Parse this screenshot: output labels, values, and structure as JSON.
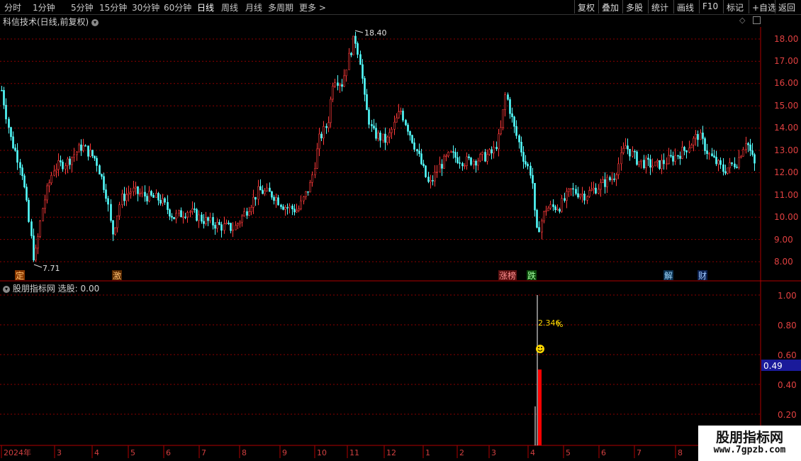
{
  "toolbar": {
    "tabs": [
      "分时",
      "1分钟",
      "5分钟",
      "15分钟",
      "30分钟",
      "60分钟",
      "日线",
      "周线",
      "月线",
      "多周期",
      "更多 >"
    ],
    "active_tab": "日线",
    "right_buttons": [
      "复权",
      "叠加",
      "多股",
      "统计",
      "画线",
      "F10",
      "标记",
      "+自选",
      "返回"
    ]
  },
  "main_chart": {
    "title": "科信技术(日线,前复权)",
    "price_labels": [
      "18.00",
      "17.00",
      "16.00",
      "15.00",
      "14.00",
      "13.00",
      "12.00",
      "11.00",
      "10.00",
      "9.00",
      "8.00"
    ],
    "high_marker": "18.40",
    "low_marker": "7.71",
    "event_tags": [
      {
        "text": "定",
        "color": "#ffb060",
        "bg": "#8a3a00"
      },
      {
        "text": "激",
        "color": "#ffb060",
        "bg": "#5a2a00"
      },
      {
        "text": "涨榜",
        "color": "#ff9090",
        "bg": "#5a1010"
      },
      {
        "text": "跌",
        "color": "#a0ffa0",
        "bg": "#0a4a0a"
      },
      {
        "text": "解",
        "color": "#9fd8ff",
        "bg": "#0a3050"
      },
      {
        "text": "财",
        "color": "#9fc8ff",
        "bg": "#0a2050"
      }
    ]
  },
  "indicator": {
    "title": "股朋指标网",
    "value_label": "选股:",
    "value": "0.00",
    "scale_labels": [
      "1.00",
      "0.80",
      "0.60",
      "0.40",
      "0.20"
    ],
    "current_value_box": "0.49",
    "annotation": "2.346",
    "percent_sign": "%",
    "smiley_icon": "smiley-face-icon"
  },
  "timeline": {
    "labels": [
      "2024年",
      "3",
      "4",
      "5",
      "6",
      "7",
      "8",
      "9",
      "10",
      "11",
      "12",
      "1",
      "2",
      "3",
      "4",
      "5",
      "6",
      "7",
      "8"
    ]
  },
  "watermark": {
    "brand": "股朋指标网",
    "url": "www.7gpzb.com"
  },
  "colors": {
    "up": "#ff3a3a",
    "down": "#54ffff",
    "grid": "#8b0000",
    "axis": "#c01010",
    "value_box": "#1a1a9a"
  }
}
